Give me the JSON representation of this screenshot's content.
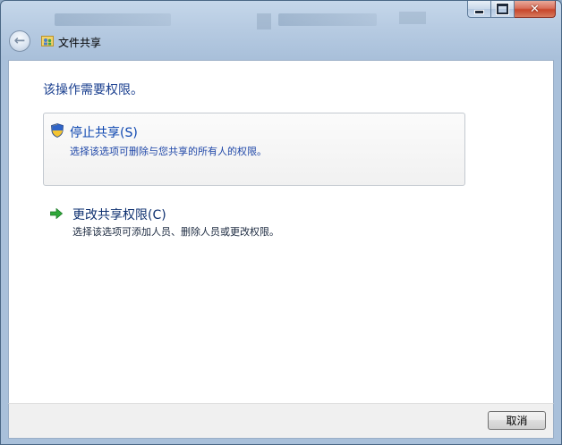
{
  "window": {
    "title": "文件共享",
    "controls": {
      "minimize_icon": "minimize-icon",
      "maximize_icon": "maximize-icon",
      "close_icon": "close-icon"
    }
  },
  "nav": {
    "back_icon": "back-arrow-icon"
  },
  "content": {
    "heading": "该操作需要权限。",
    "options": [
      {
        "icon": "uac-shield-icon",
        "title": "停止共享(S)",
        "description": "选择该选项可删除与您共享的所有人的权限。"
      },
      {
        "icon": "green-arrow-icon",
        "title": "更改共享权限(C)",
        "description": "选择该选项可添加人员、删除人员或更改权限。"
      }
    ]
  },
  "footer": {
    "cancel_label": "取消"
  },
  "colors": {
    "heading": "#1a3f8f",
    "link_blue": "#0d46b0",
    "window_frame": "#b7cbe2",
    "close_red": "#c7462b"
  }
}
